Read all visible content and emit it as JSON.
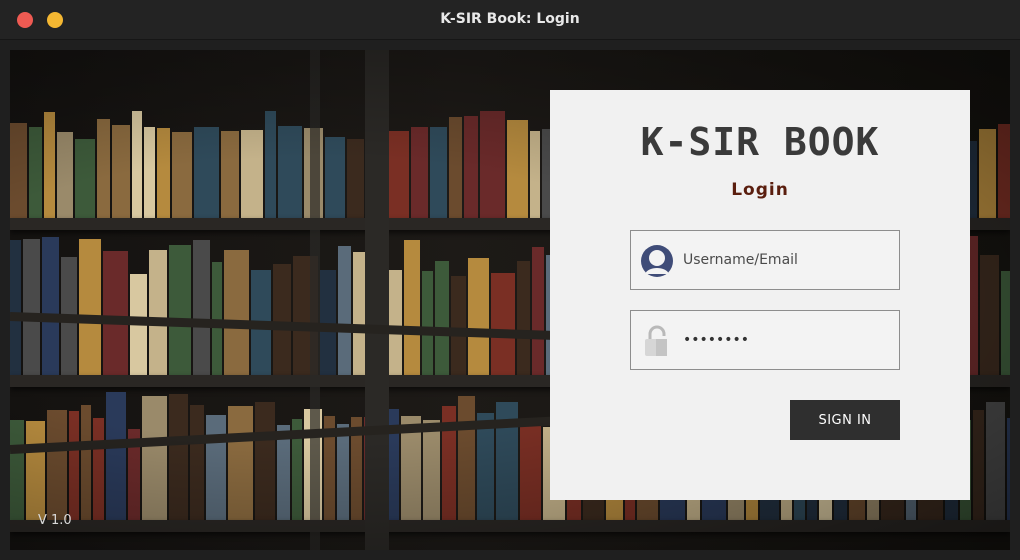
{
  "window": {
    "title": "K-SIR Book: Login",
    "controls": [
      "close",
      "minimize"
    ]
  },
  "brand": {
    "name": "K-SIR BOOK",
    "subtitle": "Login"
  },
  "form": {
    "username": {
      "placeholder": "Username/Email",
      "value": "",
      "icon": "user-avatar-icon"
    },
    "password": {
      "value": "........",
      "icon": "lock-icon"
    },
    "submit_label": "SIGN IN"
  },
  "footer": {
    "version": "V 1.0"
  },
  "colors": {
    "panel_bg": "#f1f1f1",
    "button_bg": "#2f2f2f",
    "subtitle": "#5a1e0e",
    "close": "#ee5a52",
    "minimize": "#f4b732"
  }
}
